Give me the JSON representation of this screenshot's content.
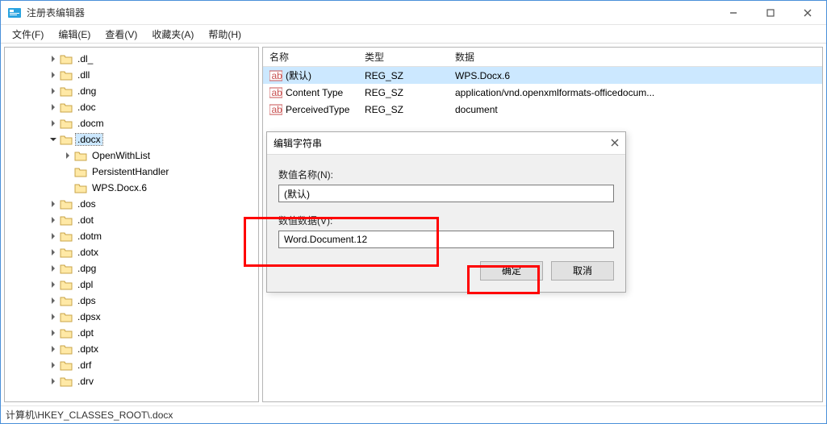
{
  "app": {
    "title": "注册表编辑器"
  },
  "window_controls": {
    "minimize": "—",
    "maximize": "▢",
    "close": "✕"
  },
  "menu": {
    "file": "文件(F)",
    "edit": "编辑(E)",
    "view": "查看(V)",
    "fav": "收藏夹(A)",
    "help": "帮助(H)"
  },
  "tree": {
    "items": [
      {
        "depth": 2,
        "expand": "right",
        "label": ".dl_"
      },
      {
        "depth": 2,
        "expand": "right",
        "label": ".dll"
      },
      {
        "depth": 2,
        "expand": "right",
        "label": ".dng"
      },
      {
        "depth": 2,
        "expand": "right",
        "label": ".doc"
      },
      {
        "depth": 2,
        "expand": "right",
        "label": ".docm"
      },
      {
        "depth": 2,
        "expand": "down",
        "label": ".docx",
        "selected": true
      },
      {
        "depth": 3,
        "expand": "right",
        "label": "OpenWithList"
      },
      {
        "depth": 3,
        "expand": "none",
        "label": "PersistentHandler"
      },
      {
        "depth": 3,
        "expand": "none",
        "label": "WPS.Docx.6"
      },
      {
        "depth": 2,
        "expand": "right",
        "label": ".dos"
      },
      {
        "depth": 2,
        "expand": "right",
        "label": ".dot"
      },
      {
        "depth": 2,
        "expand": "right",
        "label": ".dotm"
      },
      {
        "depth": 2,
        "expand": "right",
        "label": ".dotx"
      },
      {
        "depth": 2,
        "expand": "right",
        "label": ".dpg"
      },
      {
        "depth": 2,
        "expand": "right",
        "label": ".dpl"
      },
      {
        "depth": 2,
        "expand": "right",
        "label": ".dps"
      },
      {
        "depth": 2,
        "expand": "right",
        "label": ".dpsx"
      },
      {
        "depth": 2,
        "expand": "right",
        "label": ".dpt"
      },
      {
        "depth": 2,
        "expand": "right",
        "label": ".dptx"
      },
      {
        "depth": 2,
        "expand": "right",
        "label": ".drf"
      },
      {
        "depth": 2,
        "expand": "right",
        "label": ".drv"
      }
    ]
  },
  "list": {
    "col_name": "名称",
    "col_type": "类型",
    "col_data": "数据",
    "rows": [
      {
        "name": "(默认)",
        "type": "REG_SZ",
        "data": "WPS.Docx.6",
        "selected": true
      },
      {
        "name": "Content Type",
        "type": "REG_SZ",
        "data": "application/vnd.openxmlformats-officedocum..."
      },
      {
        "name": "PerceivedType",
        "type": "REG_SZ",
        "data": "document"
      }
    ]
  },
  "dialog": {
    "title": "编辑字符串",
    "name_label": "数值名称(N):",
    "name_value": "(默认)",
    "data_label": "数值数据(V):",
    "data_value": "Word.Document.12",
    "ok": "确定",
    "cancel": "取消"
  },
  "status": {
    "path": "计算机\\HKEY_CLASSES_ROOT\\.docx"
  }
}
